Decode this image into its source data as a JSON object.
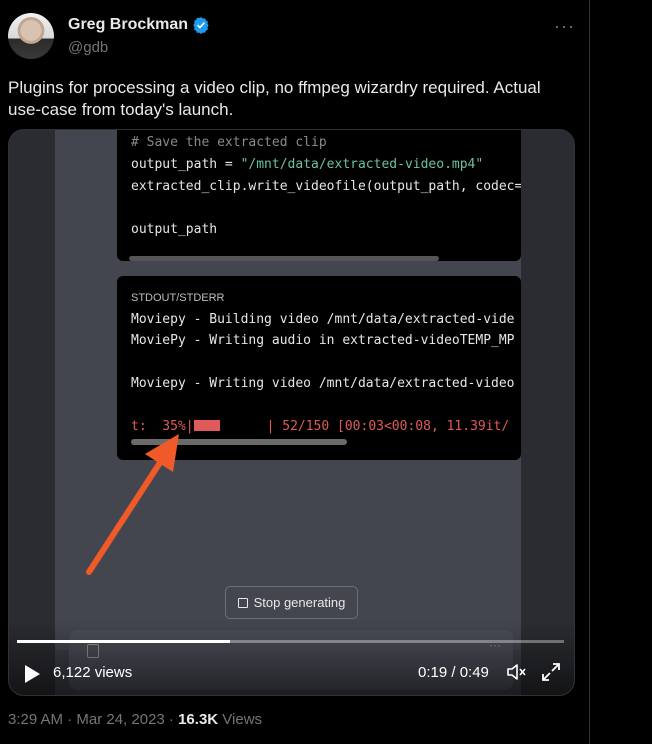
{
  "author": {
    "name": "Greg Brockman",
    "handle": "@gdb"
  },
  "more_label": "···",
  "tweet_text": "Plugins for processing a video clip, no ffmpeg wizardry required. Actual use-case from today's launch.",
  "video": {
    "code_lines": [
      "# Save the extracted clip",
      "output_path = \"/mnt/data/extracted-video.mp4\"",
      "extracted_clip.write_videofile(output_path, codec=",
      "output_path"
    ],
    "output_label": "STDOUT/STDERR",
    "output_lines": [
      "Moviepy - Building video /mnt/data/extracted-vide",
      "MoviePy - Writing audio in extracted-videoTEMP_MP",
      "Moviepy - Writing video /mnt/data/extracted-video"
    ],
    "progress_line": {
      "prefix": "t:  35%|",
      "suffix": "      | 52/150 [00:03<00:08, 11.39it/"
    },
    "stop_label": "Stop generating",
    "views": "6,122 views",
    "time": "0:19 / 0:49",
    "playback_progress": 0.39
  },
  "meta": {
    "timestamp": "3:29 AM · Mar 24, 2023 · ",
    "views_count": "16.3K",
    "views_label": " Views"
  },
  "colors": {
    "verified": "#1d9bf0",
    "arrow": "#f05a28",
    "progress_red": "#e05a5a"
  },
  "icons": [
    "verified-icon",
    "more-icon",
    "play-icon",
    "volume-icon",
    "fullscreen-icon",
    "arrow-annotation"
  ]
}
